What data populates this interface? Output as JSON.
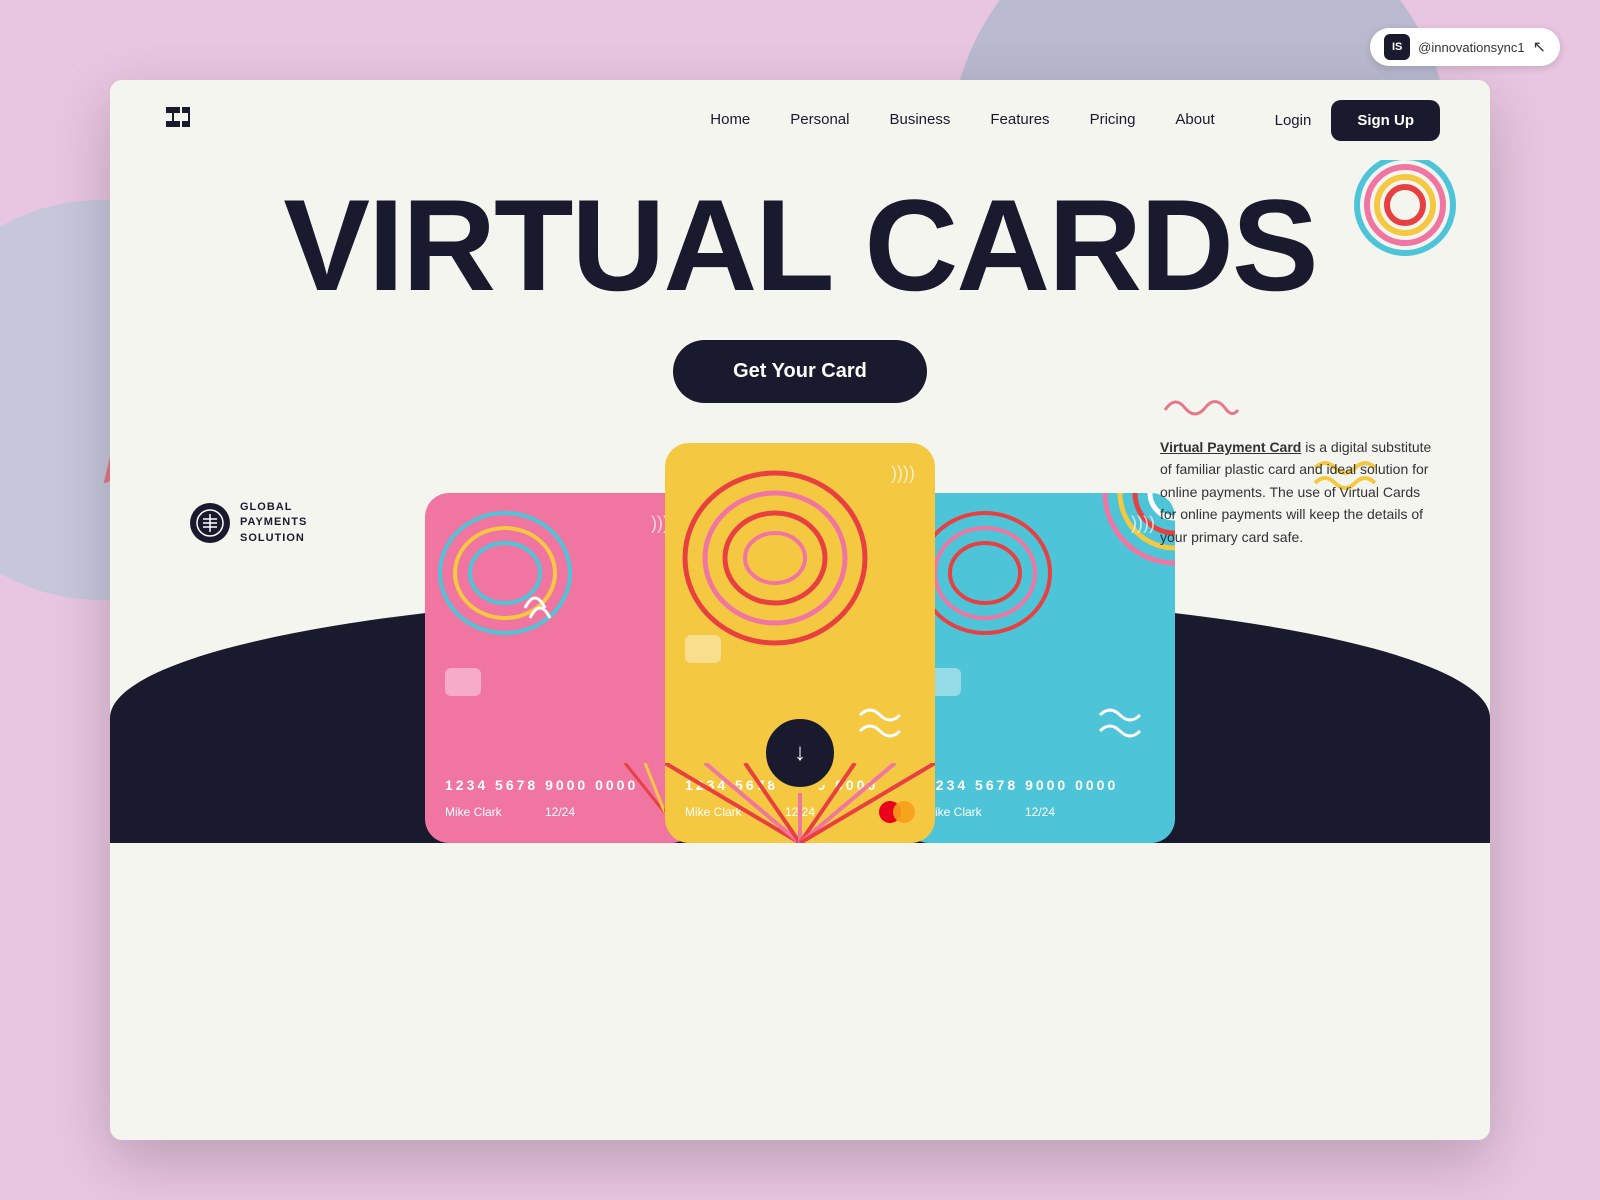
{
  "cursor_badge": {
    "initials": "IS",
    "username": "@innovationsync1"
  },
  "navbar": {
    "logo": "⊟",
    "links": [
      "Home",
      "Personal",
      "Business",
      "Features",
      "Pricing",
      "About"
    ],
    "login_label": "Login",
    "signup_label": "Sign Up"
  },
  "hero": {
    "title": "VIRTUAL CARDS",
    "cta_label": "Get Your Card"
  },
  "description": {
    "squiggle": "∿∿∿∿",
    "bold_text": "Virtual Payment Card",
    "body": " is a digital substitute of familiar plastic card and ideal solution for online payments. The use of Virtual Cards for online payments will keep the details of your primary card safe."
  },
  "partner": {
    "line1": "GLOBAL",
    "line2": "PAYMENTS",
    "line3": "SOLUTION"
  },
  "cards": [
    {
      "color": "pink",
      "number": "1234  5678  9000  0000",
      "name": "Mike Clark",
      "expiry": "12/24"
    },
    {
      "color": "yellow",
      "number": "1234  5678  9000  0000",
      "name": "Mike Clark",
      "expiry": "12/24"
    },
    {
      "color": "blue",
      "number": "1234  5678  9000  0000",
      "name": "Mike Clark",
      "expiry": "12/24"
    }
  ],
  "download_btn": {
    "icon": "↓"
  },
  "colors": {
    "dark": "#1a1a2e",
    "pink_card": "#f075a0",
    "yellow_card": "#f5c842",
    "blue_card": "#4ec4d8",
    "bg": "#e8c5e0",
    "window_bg": "#f5f5f0"
  }
}
